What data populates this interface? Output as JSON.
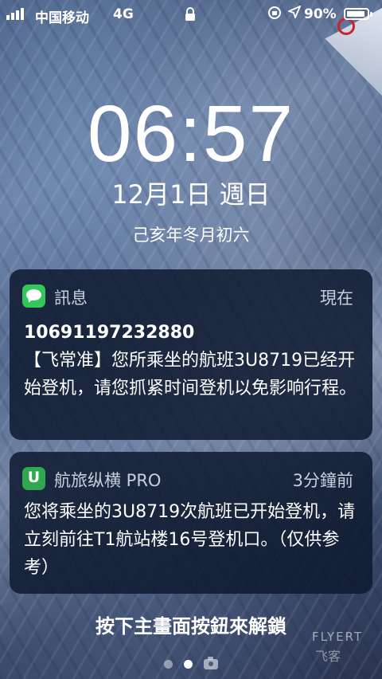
{
  "status_bar": {
    "carrier": "中国移动",
    "network": "4G",
    "battery_percent": "90%",
    "battery_level": 0.9,
    "signal_bars": 4
  },
  "lock_screen": {
    "time": "06:57",
    "date": "12月1日 週日",
    "lunar_date": "己亥年冬月初六",
    "unlock_hint": "按下主畫面按鈕來解鎖"
  },
  "notifications": [
    {
      "app": "訊息",
      "time": "現在",
      "title": "10691197232880",
      "body": "【飞常准】您所乘坐的航班3U8719已经开始登机，请您抓紧时间登机以免影响行程。"
    },
    {
      "app": "航旅纵横 PRO",
      "time": "3分鐘前",
      "body": "您将乘坐的3U8719次航班已开始登机，请立刻前往T1航站楼16号登机口。（仅供参考）"
    }
  ],
  "watermark": {
    "text": "FLYERT",
    "cn": "飞客"
  },
  "colors": {
    "messages_green": "#34c759",
    "hanglv_green": "#2fa84f",
    "card": "#0e1a30"
  }
}
